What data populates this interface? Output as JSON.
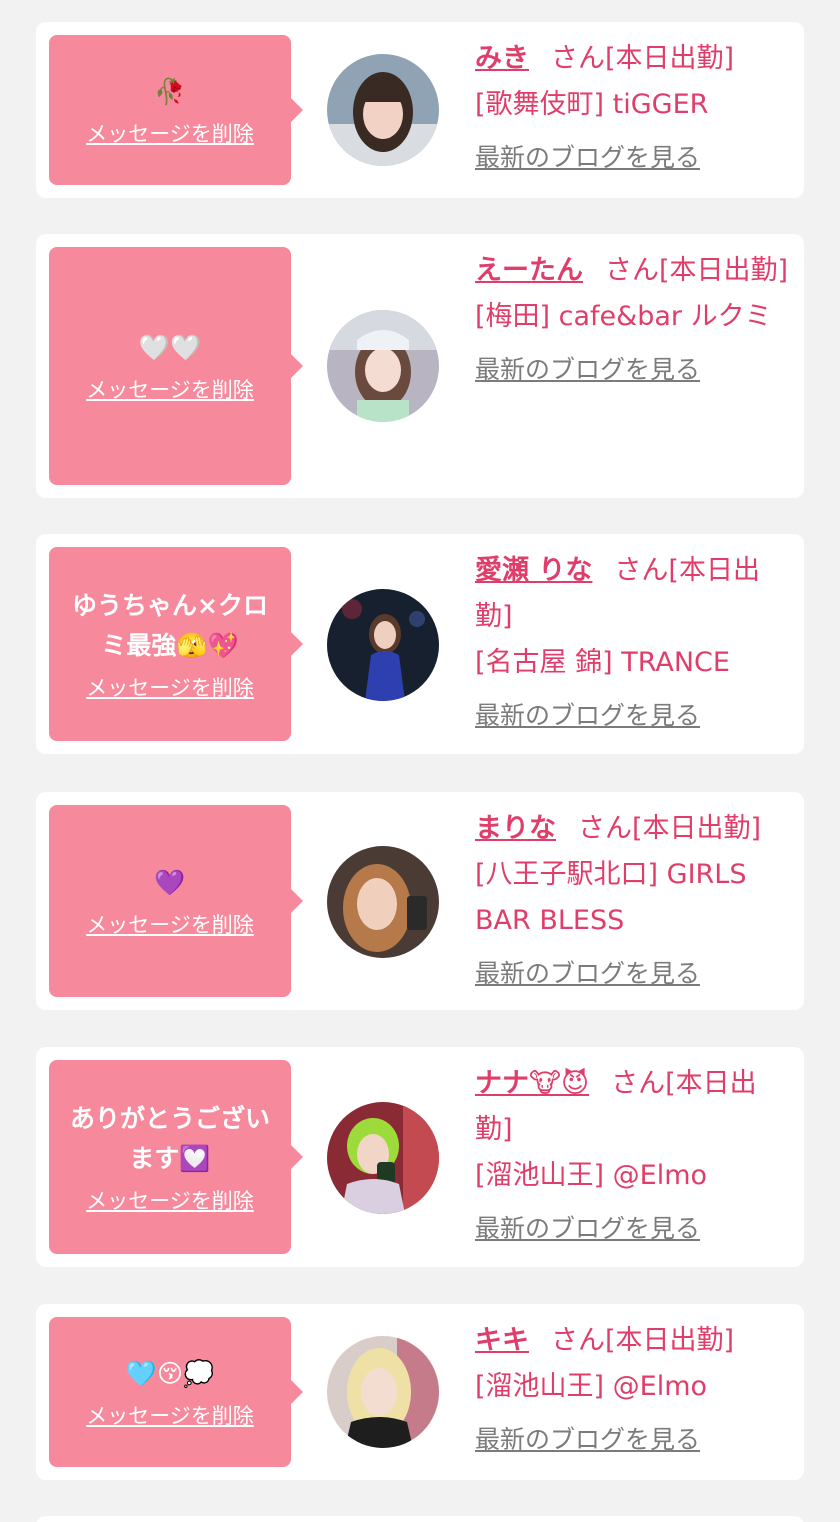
{
  "delete_label": "メッセージを削除",
  "blog_label": "最新のブログを見る",
  "suffix": "さん[本日出勤]",
  "cards": [
    {
      "message": "🥀",
      "name": "みき",
      "location": "[歌舞伎町] tiGGER",
      "avatar_icon": "avatar-photo-miki"
    },
    {
      "message": "🤍🤍",
      "name": "えーたん",
      "location": "[梅田] cafe&bar ルクミ",
      "avatar_icon": "avatar-photo-etan"
    },
    {
      "message": "ゆうちゃん×クロミ最強🫣💖",
      "name": "愛瀬 りな",
      "location": "[名古屋 錦] TRANCE",
      "avatar_icon": "avatar-photo-rina"
    },
    {
      "message": "💜",
      "name": "まりな",
      "location": "[八王子駅北口] GIRLS BAR BLESS",
      "avatar_icon": "avatar-photo-marina"
    },
    {
      "message": "ありがとうございます💟",
      "name": "ナナ🐮😈",
      "location": "[溜池山王] @Elmo",
      "avatar_icon": "avatar-photo-nana"
    },
    {
      "message": "🩵😚💭",
      "name": "キキ",
      "location": "[溜池山王] @Elmo",
      "avatar_icon": "avatar-photo-kiki"
    }
  ],
  "colors": {
    "bubble": "#f7899c",
    "accent": "#e03e6a",
    "link_gray": "#7b7b7b",
    "background": "#f2f2f2"
  }
}
